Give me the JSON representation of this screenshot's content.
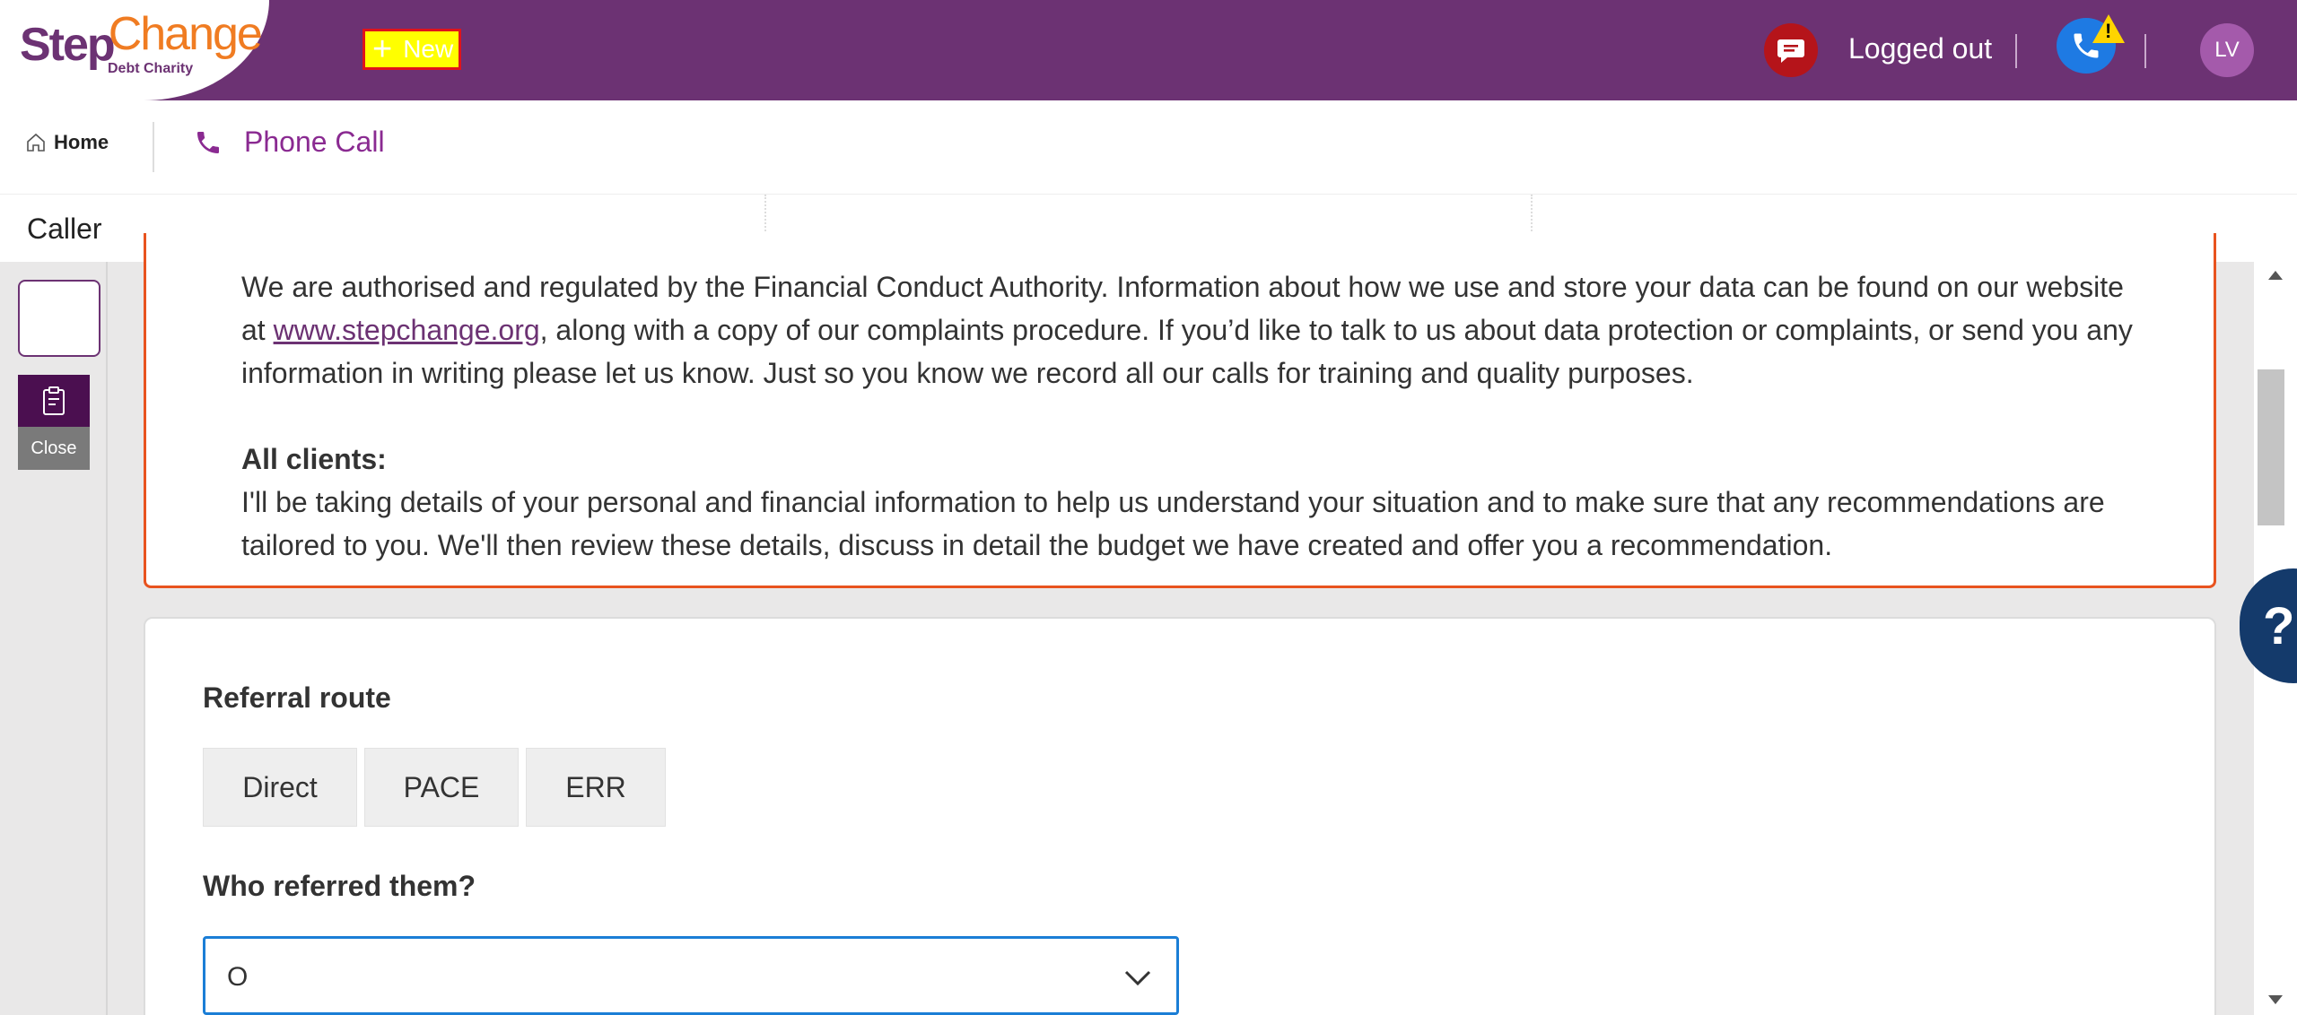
{
  "header": {
    "logo_step": "Step",
    "logo_change": "Change",
    "logo_sub": "Debt Charity",
    "new_button": "New",
    "status": "Logged out",
    "avatar_initials": "LV"
  },
  "nav": {
    "home": "Home",
    "active_tab": "Phone Call"
  },
  "caller_bar": {
    "label": "Caller"
  },
  "rail": {
    "close_label": "Close"
  },
  "alert": {
    "para1_start": "We are authorised and regulated by the Financial Conduct Authority. Information about how we use and store your data can be found on our website at ",
    "link_text": "www.stepchange.org",
    "para1_end": ", along with a copy of our complaints procedure. If you’d like to talk to us about data protection or complaints, or send you any information in writing please let us know. Just so you know we record all our calls for training and quality purposes.",
    "all_clients_heading": "All clients:",
    "all_clients_text": "I'll be taking details of your personal and financial information to help us understand your situation and to make sure that any recommendations are tailored to you. We'll then review these details, discuss in detail the budget we have created and offer you a recommendation."
  },
  "form": {
    "referral_title": "Referral route",
    "referral_options": [
      "Direct",
      "PACE",
      "ERR"
    ],
    "who_title": "Who referred them?",
    "who_value": "O"
  },
  "help": {
    "label": "?"
  },
  "colors": {
    "brand_purple": "#6c3273",
    "brand_orange": "#f07c22",
    "alert_border": "#e8531f",
    "focus_blue": "#1b7ed6"
  }
}
